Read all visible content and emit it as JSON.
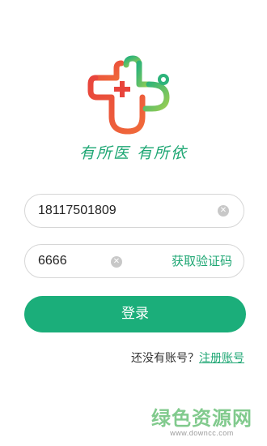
{
  "app": {
    "slogan": "有所医 有所依"
  },
  "login_form": {
    "phone_value": "18117501809",
    "code_value": "6666",
    "get_code_label": "获取验证码",
    "clear_icon": "clear-icon",
    "login_label": "登录"
  },
  "register": {
    "prompt": "还没有账号？",
    "link_label": "注册账号"
  },
  "watermark": {
    "title": "绿色资源网",
    "url": "www.downcc.com"
  },
  "colors": {
    "accent_green": "#1bae7a",
    "logo_red": "#e8443c",
    "logo_green": "#1fa774"
  }
}
